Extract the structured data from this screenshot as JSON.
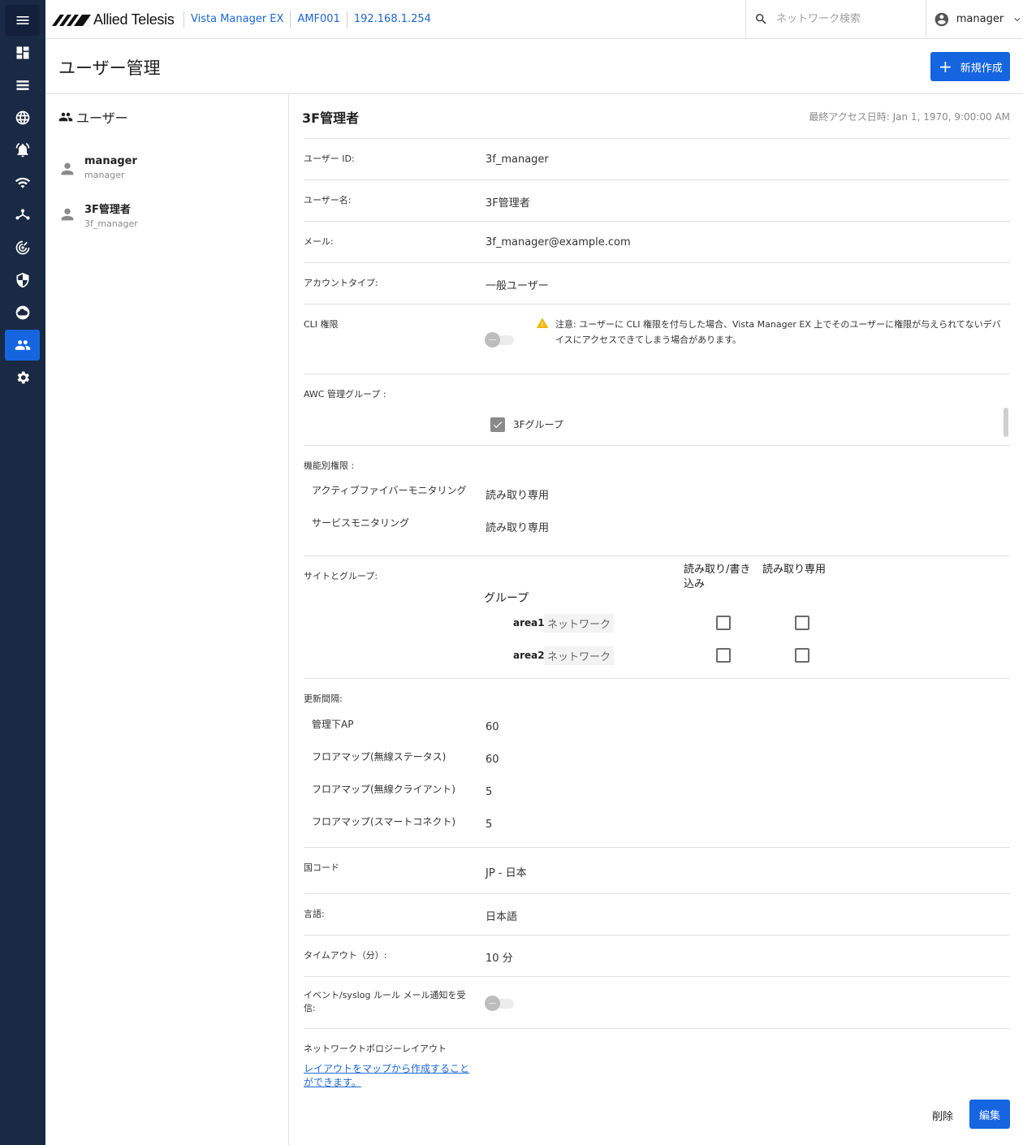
{
  "header": {
    "logo_text": "Allied Telesis",
    "breadcrumbs": [
      "Vista Manager EX",
      "AMF001",
      "192.168.1.254"
    ],
    "search_placeholder": "ネットワーク検索",
    "username": "manager"
  },
  "page": {
    "title": "ユーザー管理",
    "new_button": "新規作成"
  },
  "users_panel": {
    "heading": "ユーザー",
    "users": [
      {
        "name": "manager",
        "id": "manager"
      },
      {
        "name": "3F管理者",
        "id": "3f_manager"
      }
    ]
  },
  "detail": {
    "title": "3F管理者",
    "last_access": "最終アクセス日時: Jan 1, 1970, 9:00:00 AM",
    "user_id_label": "ユーザー ID:",
    "user_id": "3f_manager",
    "user_name_label": "ユーザー名:",
    "user_name": "3F管理者",
    "mail_label": "メール:",
    "mail": "3f_manager@example.com",
    "account_type_label": "アカウントタイプ:",
    "account_type": "一般ユーザー",
    "cli_label": "CLI 権限",
    "cli_enabled": false,
    "cli_warning": "注意: ユーザーに CLI 権限を付与した場合、Vista Manager EX 上でそのユーザーに権限が与えられてないデバイスにアクセスできてしまう場合があります。",
    "awc_label": "AWC 管理グループ :",
    "awc_groups": [
      {
        "name": "3Fグループ",
        "checked": true
      }
    ],
    "func_label": "機能別権限 :",
    "func_perms": [
      {
        "name": "アクティブファイバーモニタリング",
        "value": "読み取り専用"
      },
      {
        "name": "サービスモニタリング",
        "value": "読み取り専用"
      }
    ],
    "sites_label": "サイトとグループ:",
    "col_rw": "読み取り/書き込み",
    "col_ro": "読み取り専用",
    "group_heading": "グループ",
    "areas": [
      {
        "name": "area1",
        "tag": "ネットワーク",
        "rw": false,
        "ro": false
      },
      {
        "name": "area2",
        "tag": "ネットワーク",
        "rw": false,
        "ro": false
      }
    ],
    "refresh_label": "更新間隔:",
    "refresh": [
      {
        "name": "管理下AP",
        "value": "60"
      },
      {
        "name": "フロアマップ(無線ステータス)",
        "value": "60"
      },
      {
        "name": "フロアマップ(無線クライアント)",
        "value": "5"
      },
      {
        "name": "フロアマップ(スマートコネクト)",
        "value": "5"
      }
    ],
    "country_label": "国コード",
    "country": "JP - 日本",
    "lang_label": "言語:",
    "lang": "日本語",
    "timeout_label": "タイムアウト（分）:",
    "timeout": "10 分",
    "event_label": "イベント/syslog ルール メール通知を受信:",
    "event_enabled": false,
    "topo_label": "ネットワークトポロジーレイアウト",
    "topo_link": "レイアウトをマップから作成することができます。",
    "delete_button": "削除",
    "edit_button": "編集"
  },
  "colors": {
    "rail": "#1a2a44",
    "accent": "#1565e0",
    "link": "#1a66d8",
    "warning": "#f2b705"
  }
}
